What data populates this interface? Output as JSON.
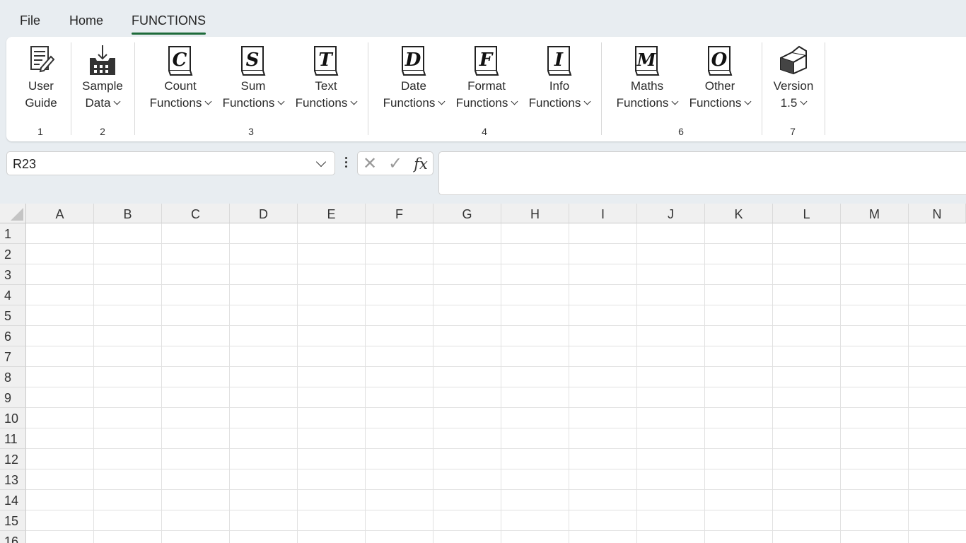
{
  "menu": {
    "tabs": [
      {
        "label": "File"
      },
      {
        "label": "Home"
      },
      {
        "label": "FUNCTIONS"
      }
    ]
  },
  "ribbon": {
    "buttons": [
      {
        "line1": "User",
        "line2": "Guide",
        "icon": "user-guide-icon"
      },
      {
        "line1": "Sample",
        "line2": "Data",
        "icon": "import-data-icon"
      },
      {
        "line1": "Count",
        "line2": "Functions",
        "icon": "book-c-icon",
        "letter": "C"
      },
      {
        "line1": "Sum",
        "line2": "Functions",
        "icon": "book-s-icon",
        "letter": "S"
      },
      {
        "line1": "Text",
        "line2": "Functions",
        "icon": "book-t-icon",
        "letter": "T"
      },
      {
        "line1": "Date",
        "line2": "Functions",
        "icon": "book-d-icon",
        "letter": "D"
      },
      {
        "line1": "Format",
        "line2": "Functions",
        "icon": "book-f-icon",
        "letter": "F"
      },
      {
        "line1": "Info",
        "line2": "Functions",
        "icon": "book-i-icon",
        "letter": "I"
      },
      {
        "line1": "Maths",
        "line2": "Functions",
        "icon": "book-m-icon",
        "letter": "M"
      },
      {
        "line1": "Other",
        "line2": "Functions",
        "icon": "book-o-icon",
        "letter": "O"
      },
      {
        "line1": "Version",
        "line2": "1.5",
        "icon": "version-box-icon"
      }
    ],
    "groups": [
      "1",
      "2",
      "3",
      "4",
      "6",
      "7"
    ]
  },
  "formula_bar": {
    "name_box": "R23",
    "formula": ""
  },
  "sheet": {
    "columns": [
      "A",
      "B",
      "C",
      "D",
      "E",
      "F",
      "G",
      "H",
      "I",
      "J",
      "K",
      "L",
      "M",
      "N"
    ],
    "rows": [
      "1",
      "2",
      "3",
      "4",
      "5",
      "6",
      "7",
      "8",
      "9",
      "10",
      "11",
      "12",
      "13",
      "14",
      "15",
      "16"
    ]
  },
  "colors": {
    "accent": "#1e6b3a",
    "background": "#e8edf1"
  }
}
